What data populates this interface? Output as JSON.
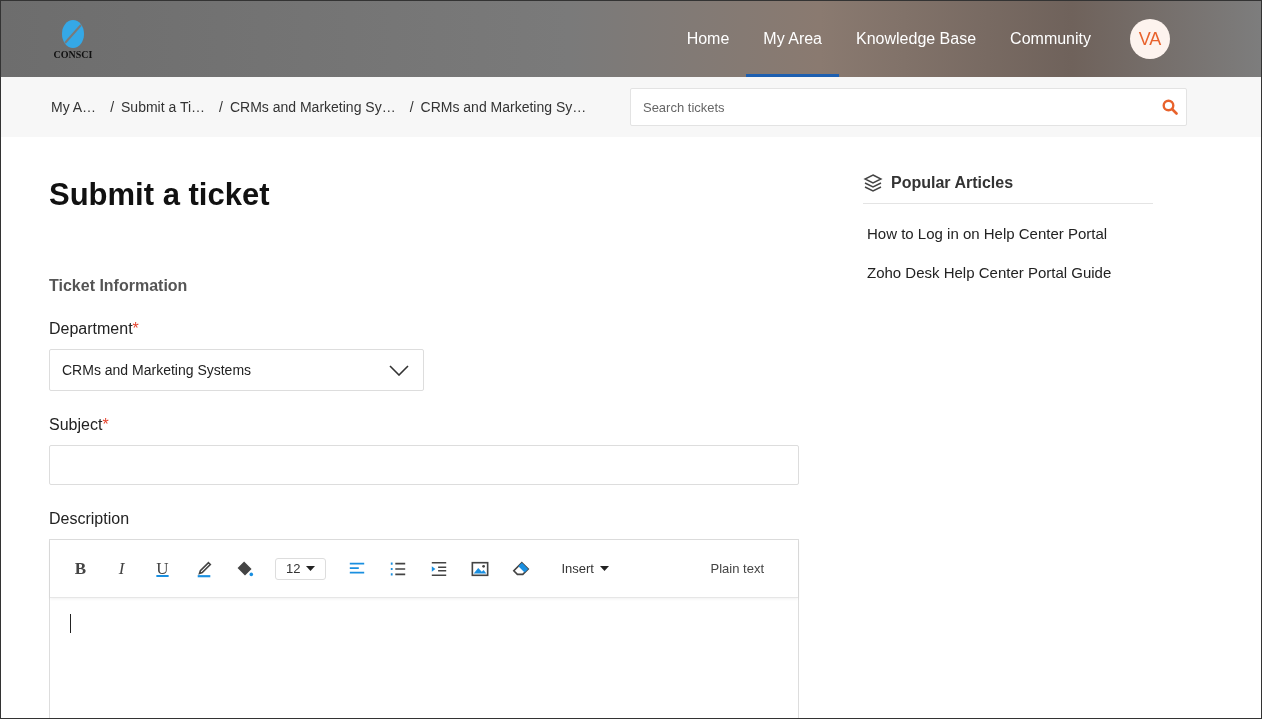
{
  "header": {
    "logo_text": "CONSCI",
    "nav": [
      {
        "label": "Home",
        "selected": false
      },
      {
        "label": "My Area",
        "selected": true
      },
      {
        "label": "Knowledge Base",
        "selected": false
      },
      {
        "label": "Community",
        "selected": false
      }
    ],
    "avatar": "VA"
  },
  "breadcrumbs": [
    {
      "label": "My A…"
    },
    {
      "separator": "/",
      "label": "Submit a Ti…"
    },
    {
      "separator": "/",
      "label": "CRMs and Marketing Sy…"
    },
    {
      "separator": "/",
      "label": "CRMs and Marketing Sy…"
    }
  ],
  "search": {
    "placeholder": "Search tickets"
  },
  "page_title": "Submit a ticket",
  "section_title": "Ticket Information",
  "fields": [
    {
      "kind": "select",
      "label": "Department",
      "required_mark": "*",
      "value": "CRMs and Marketing Systems"
    },
    {
      "kind": "text",
      "label": "Subject",
      "required_mark": "*"
    },
    {
      "kind": "editor",
      "label": "Description"
    }
  ],
  "editor_toolbar": [
    {
      "kind": "letter",
      "text": "B"
    },
    {
      "kind": "letter",
      "text": "I"
    },
    {
      "kind": "letter",
      "text": "U"
    },
    {
      "kind": "icon"
    },
    {
      "kind": "icon"
    },
    {
      "kind": "dropdown",
      "text": "12"
    },
    {
      "kind": "icon"
    },
    {
      "kind": "icon"
    },
    {
      "kind": "icon"
    },
    {
      "kind": "icon"
    },
    {
      "kind": "icon"
    },
    {
      "kind": "dropdown",
      "text": "Insert"
    }
  ],
  "editor_mode": "Plain text",
  "sidebar": {
    "title": "Popular Articles",
    "articles": [
      "How to Log in on Help Center Portal",
      "Zoho Desk Help Center Portal Guide"
    ]
  }
}
